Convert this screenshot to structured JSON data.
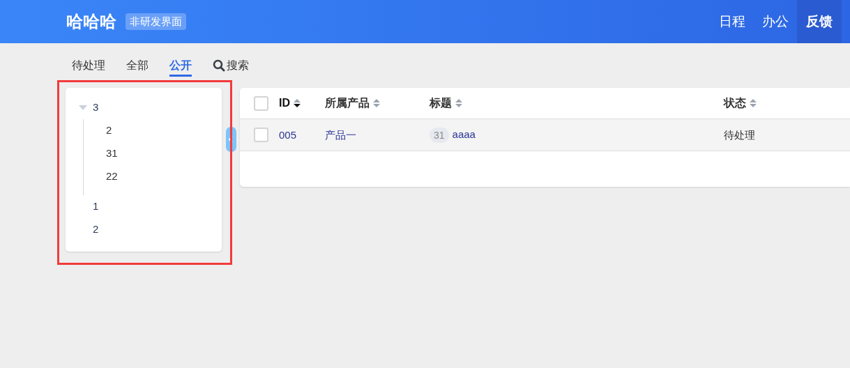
{
  "header": {
    "title": "哈哈哈",
    "badge": "非研发界面",
    "nav": [
      {
        "label": "日程",
        "selected": false
      },
      {
        "label": "办公",
        "selected": false
      },
      {
        "label": "反馈",
        "selected": true
      }
    ]
  },
  "tabs": [
    {
      "label": "待处理",
      "selected": false
    },
    {
      "label": "全部",
      "selected": false
    },
    {
      "label": "公开",
      "selected": true
    }
  ],
  "search": {
    "label": "搜索"
  },
  "tree": [
    {
      "label": "3",
      "expanded": true,
      "children": [
        {
          "label": "2"
        },
        {
          "label": "31"
        },
        {
          "label": "22"
        }
      ]
    },
    {
      "label": "1"
    },
    {
      "label": "2"
    }
  ],
  "table": {
    "all_checked": false,
    "columns": [
      {
        "label": "ID",
        "sorted_descending": true
      },
      {
        "label": "所属产品",
        "sorted_descending": false
      },
      {
        "label": "标题",
        "sorted_descending": false
      },
      {
        "label": "状态",
        "sorted_descending": false
      }
    ],
    "rows": [
      {
        "checked": false,
        "id": "005",
        "product": "产品一",
        "count": "31",
        "title": "aaaa",
        "status": "待处理"
      }
    ]
  }
}
